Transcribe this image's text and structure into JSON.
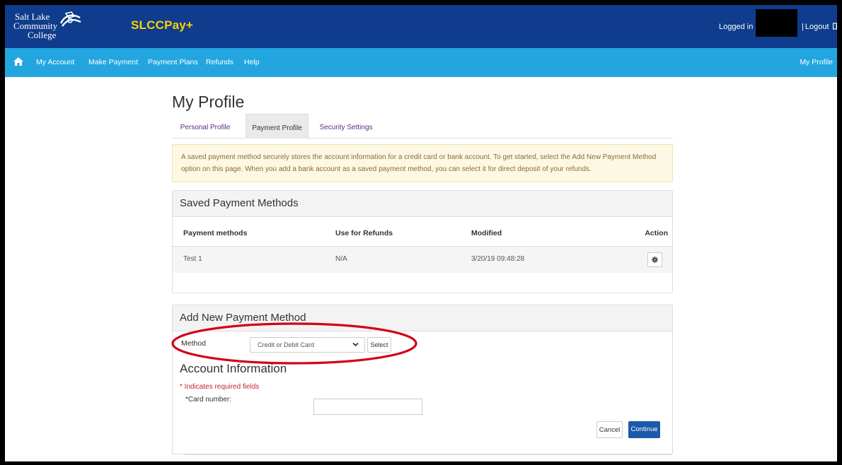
{
  "header": {
    "logo_line1": "Salt Lake",
    "logo_line2": "Community",
    "logo_line3": "College",
    "app_title": "SLCCPay+",
    "logged_in_text": "Logged in a",
    "logout_text": "Logout",
    "logout_separator": "|"
  },
  "nav": {
    "items": [
      "My Account",
      "Make Payment",
      "Payment Plans",
      "Refunds",
      "Help"
    ],
    "right_label": "My Profile"
  },
  "page": {
    "title": "My Profile",
    "tabs": [
      "Personal Profile",
      "Payment Profile",
      "Security Settings"
    ],
    "active_tab": "Payment Profile",
    "alert_text": "A saved payment method securely stores the account information for a credit card or bank account. To get started, select the Add New Payment Method option on this page. When you add a bank account as a saved payment method, you can select it for direct deposit of your refunds."
  },
  "saved_methods": {
    "heading": "Saved Payment Methods",
    "columns": [
      "Payment methods",
      "Use for Refunds",
      "Modified",
      "Action"
    ],
    "rows": [
      {
        "name": "Test 1",
        "refunds": "N/A",
        "modified": "3/20/19 09:48:28"
      }
    ]
  },
  "add_method": {
    "heading": "Add New Payment Method",
    "method_label": "Method",
    "method_value": "Credit or Debit Card",
    "select_label": "Select",
    "account_info_heading": "Account Information",
    "required_note": "* Indicates required fields",
    "card_number_label": "*Card number:",
    "card_number_value": "",
    "cancel_label": "Cancel",
    "continue_label": "Continue"
  },
  "colors": {
    "header_bg": "#0f3c8c",
    "nav_bg": "#23a6e0",
    "title_accent": "#ffd200",
    "primary_button": "#1a5aa8",
    "annotation_oval": "#d0021b"
  },
  "icons": {
    "home": "home-icon",
    "logout": "logout-icon",
    "gear": "gear-icon",
    "dropdown": "chevron-down-icon",
    "logo_mark": "logo-mark-icon"
  }
}
